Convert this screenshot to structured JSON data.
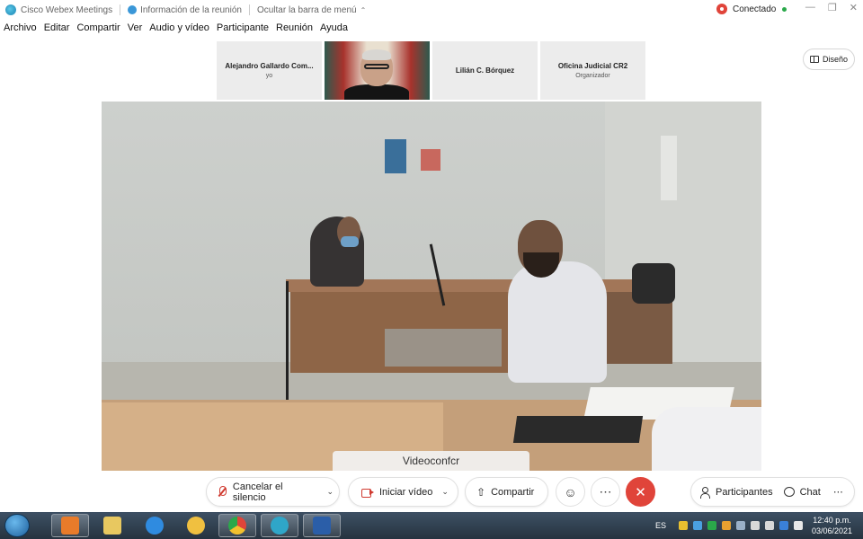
{
  "titlebar": {
    "app_title": "Cisco Webex Meetings",
    "info_label": "Información de la reunión",
    "hide_menu_label": "Ocultar la barra de menú",
    "status_label": "Conectado"
  },
  "menu": [
    "Archivo",
    "Editar",
    "Compartir",
    "Ver",
    "Audio y vídeo",
    "Participante",
    "Reunión",
    "Ayuda"
  ],
  "participants": [
    {
      "name": "Alejandro Gallardo Com...",
      "sub": "yo"
    },
    {
      "name": "",
      "sub": ""
    },
    {
      "name": "Lilián C. Bórquez",
      "sub": ""
    },
    {
      "name": "Oficina Judicial CR2",
      "sub": "Organizador"
    }
  ],
  "layout_button": "Diseño",
  "main_video": {
    "label": "Videoconfcr"
  },
  "controls": {
    "mute_label": "Cancelar el silencio",
    "video_label": "Iniciar vídeo",
    "share_label": "Compartir",
    "participants_label": "Participantes",
    "chat_label": "Chat"
  },
  "taskbar": {
    "language": "ES",
    "time": "12:40 p.m.",
    "date": "03/06/2021"
  },
  "colors": {
    "end_call": "#e0443a",
    "muted_red": "#d03a30",
    "connected_green": "#2aa84a"
  }
}
